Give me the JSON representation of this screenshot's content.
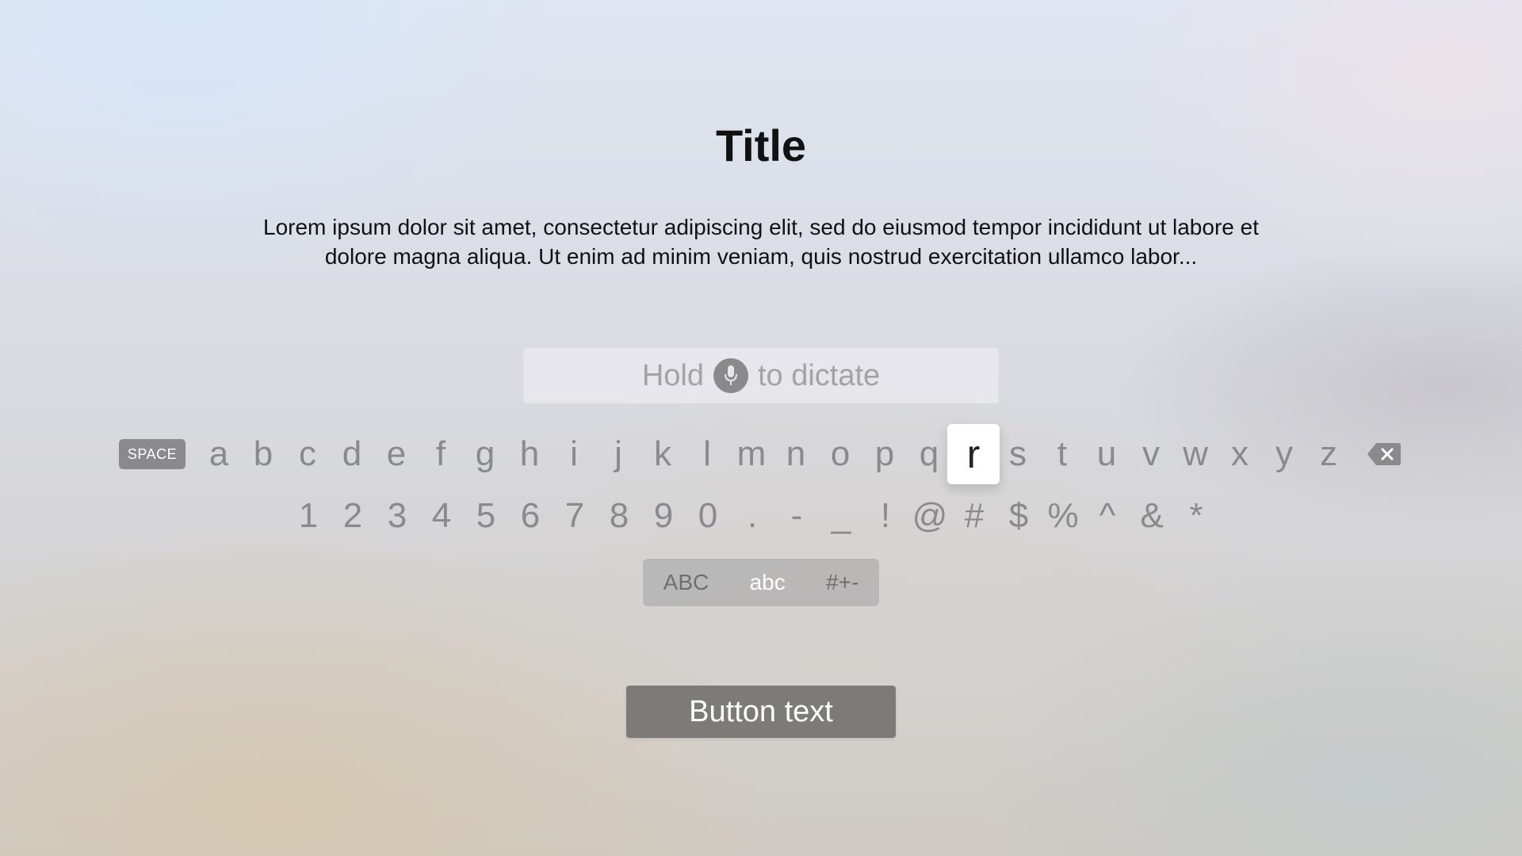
{
  "title": "Title",
  "body": "Lorem ipsum dolor sit amet, consectetur adipiscing elit, sed do eiusmod tempor incididunt ut labore et dolore magna aliqua. Ut enim ad minim veniam, quis nostrud exercitation ullamco labor...",
  "dictate": {
    "prefix": "Hold",
    "suffix": "to dictate",
    "icon": "microphone-icon"
  },
  "keyboard": {
    "space_label": "SPACE",
    "letters": [
      "a",
      "b",
      "c",
      "d",
      "e",
      "f",
      "g",
      "h",
      "i",
      "j",
      "k",
      "l",
      "m",
      "n",
      "o",
      "p",
      "q",
      "r",
      "s",
      "t",
      "u",
      "v",
      "w",
      "x",
      "y",
      "z"
    ],
    "symbols": [
      "1",
      "2",
      "3",
      "4",
      "5",
      "6",
      "7",
      "8",
      "9",
      "0",
      ".",
      "-",
      "_",
      "!",
      "@",
      "#",
      "$",
      "%",
      "^",
      "&",
      "*"
    ],
    "focused_key": "r",
    "delete_icon": "backspace-icon"
  },
  "modes": {
    "items": [
      "ABC",
      "abc",
      "#+-"
    ],
    "active": "abc"
  },
  "button": {
    "label": "Button text"
  },
  "colors": {
    "key_text": "#8a8a8c",
    "focused_key_bg": "#ffffff",
    "button_bg": "#7c7b79"
  }
}
